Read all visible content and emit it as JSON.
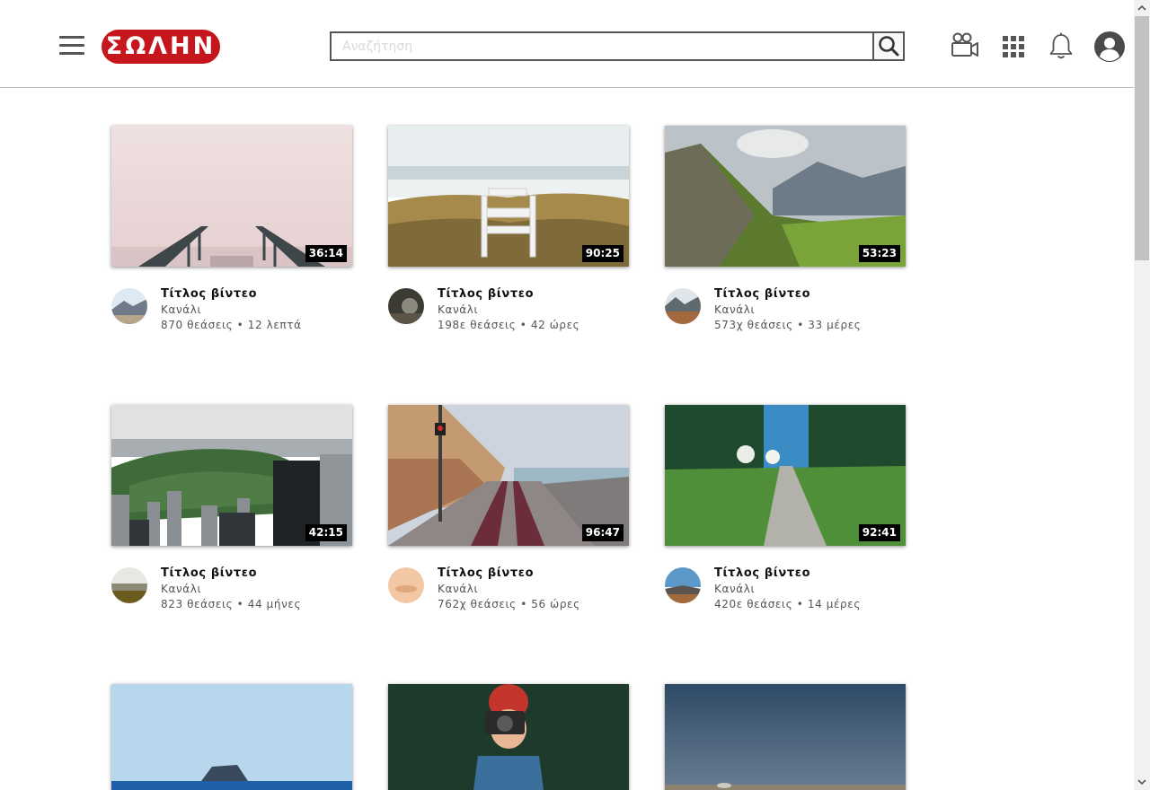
{
  "header": {
    "logo_text": "ΣΩΛΗΝ",
    "search_placeholder": "Αναζήτηση",
    "search_value": ""
  },
  "icons": {
    "menu": "hamburger-menu-icon",
    "search": "search-icon",
    "upload": "video-camera-icon",
    "apps": "apps-grid-icon",
    "notifications": "bell-icon",
    "account": "account-icon"
  },
  "colors": {
    "brand": "#c4161c",
    "duration_badge": "#000000"
  },
  "videos": [
    {
      "title": "Τίτλος βίντεο",
      "channel": "Κανάλι",
      "stats": "870 θεάσεις • 12 λεπτά",
      "duration": "36:14"
    },
    {
      "title": "Τίτλος βίντεο",
      "channel": "Κανάλι",
      "stats": "198ε θεάσεις • 42 ώρες",
      "duration": "90:25"
    },
    {
      "title": "Τίτλος βίντεο",
      "channel": "Κανάλι",
      "stats": "573χ θεάσεις • 33 μέρες",
      "duration": "53:23"
    },
    {
      "title": "Τίτλος βίντεο",
      "channel": "Κανάλι",
      "stats": "823 θεάσεις • 44 μήνες",
      "duration": "42:15"
    },
    {
      "title": "Τίτλος βίντεο",
      "channel": "Κανάλι",
      "stats": "762χ θεάσεις • 56 ώρες",
      "duration": "96:47"
    },
    {
      "title": "Τίτλος βίντεο",
      "channel": "Κανάλι",
      "stats": "420ε θεάσεις • 14 μέρες",
      "duration": "92:41"
    }
  ]
}
